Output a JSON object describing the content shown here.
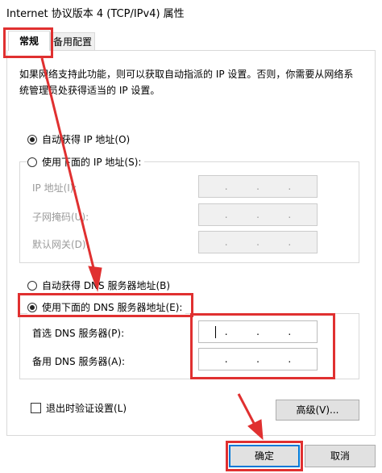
{
  "window": {
    "title": "Internet 协议版本 4 (TCP/IPv4) 属性"
  },
  "tabs": [
    {
      "label": "常规",
      "active": true
    },
    {
      "label": "备用配置",
      "active": false
    }
  ],
  "description": "如果网络支持此功能，则可以获取自动指派的 IP 设置。否则，你需要从网络系统管理员处获得适当的 IP 设置。",
  "ip_section": {
    "auto_label": "自动获得 IP 地址(O)",
    "manual_label": "使用下面的 IP 地址(S):",
    "auto_selected": true,
    "fields": [
      {
        "label": "IP 地址(I):",
        "value": ".   .   ."
      },
      {
        "label": "子网掩码(U):",
        "value": ".   .   ."
      },
      {
        "label": "默认网关(D):",
        "value": ".   .   ."
      }
    ]
  },
  "dns_section": {
    "auto_label": "自动获得 DNS 服务器地址(B)",
    "manual_label": "使用下面的 DNS 服务器地址(E):",
    "manual_selected": true,
    "fields": [
      {
        "label": "首选 DNS 服务器(P):",
        "value": ""
      },
      {
        "label": "备用 DNS 服务器(A):",
        "value": ""
      }
    ]
  },
  "validate_on_exit": {
    "label": "退出时验证设置(L)",
    "checked": false
  },
  "buttons": {
    "advanced": "高级(V)...",
    "ok": "确定",
    "cancel": "取消"
  },
  "annotation_color": "#e03030"
}
